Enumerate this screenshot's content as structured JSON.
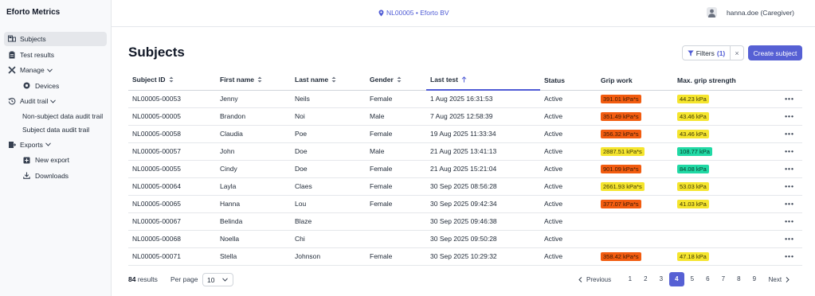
{
  "app": {
    "title": "Eforto Metrics"
  },
  "sidebar": {
    "items": [
      {
        "label": "Subjects"
      },
      {
        "label": "Test results"
      },
      {
        "label": "Manage"
      },
      {
        "label": "Devices"
      },
      {
        "label": "Audit trail"
      },
      {
        "label": "Non-subject data audit trail"
      },
      {
        "label": "Subject data audit trail"
      },
      {
        "label": "Exports"
      },
      {
        "label": "New export"
      },
      {
        "label": "Downloads"
      }
    ]
  },
  "header": {
    "org": "NL00005 • Eforto BV",
    "user": "hanna.doe (Caregiver)"
  },
  "main": {
    "title": "Subjects",
    "filters_label": "Filters",
    "filters_count": "(1)",
    "clear_label": "×",
    "create_label": "Create subject"
  },
  "table": {
    "columns": [
      "Subject ID",
      "First name",
      "Last name",
      "Gender",
      "Last test",
      "Status",
      "Grip work",
      "Max. grip strength"
    ],
    "rows": [
      {
        "id": "NL00005-00053",
        "first": "Jenny",
        "last": "Neils",
        "gender": "Female",
        "test": "1 Aug 2025 16:31:53",
        "status": "Active",
        "grip": "391.01 kPa*s",
        "grip_color": "orange",
        "max": "44.23 kPa",
        "max_color": "yellow"
      },
      {
        "id": "NL00005-00005",
        "first": "Brandon",
        "last": "Noi",
        "gender": "Male",
        "test": "7 Aug 2025 12:58:39",
        "status": "Active",
        "grip": "351.49 kPa*s",
        "grip_color": "orange",
        "max": "43.46 kPa",
        "max_color": "yellow"
      },
      {
        "id": "NL00005-00058",
        "first": "Claudia",
        "last": "Poe",
        "gender": "Female",
        "test": "19 Aug 2025 11:33:34",
        "status": "Active",
        "grip": "356.32 kPa*s",
        "grip_color": "orange",
        "max": "43.46 kPa",
        "max_color": "yellow"
      },
      {
        "id": "NL00005-00057",
        "first": "John",
        "last": "Doe",
        "gender": "Male",
        "test": "21 Aug 2025 13:41:13",
        "status": "Active",
        "grip": "2887.51 kPa*s",
        "grip_color": "yellow",
        "max": "108.77 kPa",
        "max_color": "green"
      },
      {
        "id": "NL00005-00055",
        "first": "Cindy",
        "last": "Doe",
        "gender": "Female",
        "test": "21 Aug 2025 15:21:04",
        "status": "Active",
        "grip": "901.09 kPa*s",
        "grip_color": "orange",
        "max": "84.08 kPa",
        "max_color": "green"
      },
      {
        "id": "NL00005-00064",
        "first": "Layla",
        "last": "Claes",
        "gender": "Female",
        "test": "30 Sep 2025 08:56:28",
        "status": "Active",
        "grip": "2661.93 kPa*s",
        "grip_color": "yellow",
        "max": "53.03 kPa",
        "max_color": "yellow"
      },
      {
        "id": "NL00005-00065",
        "first": "Hanna",
        "last": "Lou",
        "gender": "Female",
        "test": "30 Sep 2025 09:42:34",
        "status": "Active",
        "grip": "377.07 kPa*s",
        "grip_color": "orange",
        "max": "41.03 kPa",
        "max_color": "yellow"
      },
      {
        "id": "NL00005-00067",
        "first": "Belinda",
        "last": "Blaze",
        "gender": "",
        "test": "30 Sep 2025 09:46:38",
        "status": "Active",
        "grip": "",
        "grip_color": "",
        "max": "",
        "max_color": ""
      },
      {
        "id": "NL00005-00068",
        "first": "Noella",
        "last": "Chi",
        "gender": "",
        "test": "30 Sep 2025 09:50:28",
        "status": "Active",
        "grip": "",
        "grip_color": "",
        "max": "",
        "max_color": ""
      },
      {
        "id": "NL00005-00071",
        "first": "Stella",
        "last": "Johnson",
        "gender": "Female",
        "test": "30 Sep 2025 10:29:32",
        "status": "Active",
        "grip": "358.42 kPa*s",
        "grip_color": "orange",
        "max": "47.18 kPa",
        "max_color": "yellow"
      }
    ],
    "more_label": "•••"
  },
  "footer": {
    "results_count": "84",
    "results_label": "results",
    "per_page_label": "Per page",
    "per_page_value": "10",
    "prev_label": "Previous",
    "next_label": "Next",
    "pages": [
      "1",
      "2",
      "3",
      "4",
      "5",
      "6",
      "7",
      "8",
      "9"
    ],
    "current_page": "4"
  },
  "colors": {
    "accent": "#5660d4",
    "orange": "#f25c10",
    "yellow": "#f5e52e",
    "green": "#21d9a5"
  }
}
